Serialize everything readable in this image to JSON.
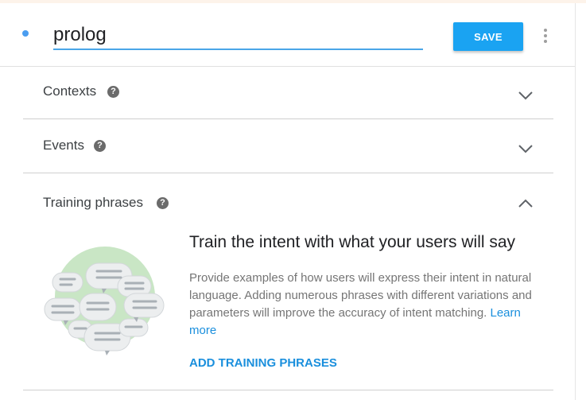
{
  "header": {
    "intent_name": "prolog",
    "save_label": "SAVE",
    "more_icon": "more-vert-icon"
  },
  "sections": [
    {
      "title": "Contexts",
      "help_glyph": "?",
      "state": "collapsed"
    },
    {
      "title": "Events",
      "help_glyph": "?",
      "state": "collapsed"
    },
    {
      "title": "Training phrases",
      "help_glyph": "?",
      "state": "expanded"
    }
  ],
  "training_empty": {
    "heading": "Train the intent with what your users will say",
    "description": "Provide examples of how users will express their intent in natural language. Adding numerous phrases with different variations and parameters will improve the accuracy of intent matching.",
    "learn_more": "Learn more",
    "action": "ADD TRAINING PHRASES"
  },
  "colors": {
    "accent": "#1aa3f2",
    "link": "#1a8fdd",
    "status_dot": "#4a9df0",
    "illustration_circle": "#c9e6c5"
  }
}
